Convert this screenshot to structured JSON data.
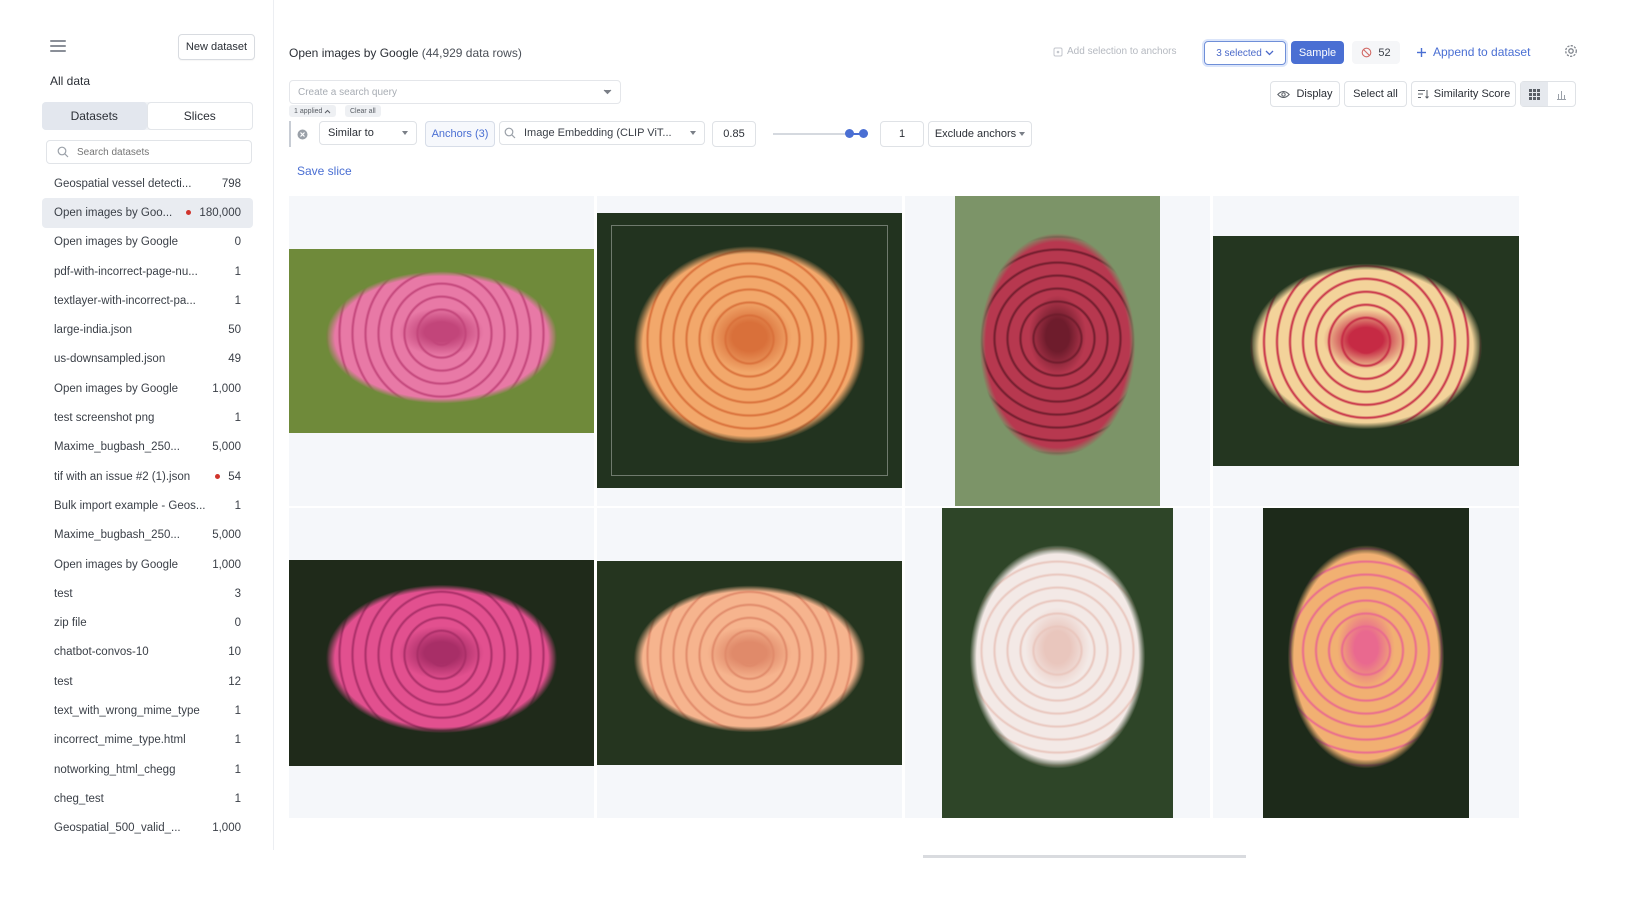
{
  "sidebar": {
    "new_dataset_label": "New dataset",
    "all_data_label": "All data",
    "tabs": [
      {
        "label": "Datasets",
        "active": true
      },
      {
        "label": "Slices",
        "active": false
      }
    ],
    "search_placeholder": "Search datasets",
    "datasets": [
      {
        "name": "Geospatial vessel detecti...",
        "count": "798",
        "alert": false,
        "selected": false
      },
      {
        "name": "Open images by Goo...",
        "count": "180,000",
        "alert": true,
        "selected": true
      },
      {
        "name": "Open images by Google",
        "count": "0",
        "alert": false,
        "selected": false
      },
      {
        "name": "pdf-with-incorrect-page-nu...",
        "count": "1",
        "alert": false,
        "selected": false
      },
      {
        "name": "textlayer-with-incorrect-pa...",
        "count": "1",
        "alert": false,
        "selected": false
      },
      {
        "name": "large-india.json",
        "count": "50",
        "alert": false,
        "selected": false
      },
      {
        "name": "us-downsampled.json",
        "count": "49",
        "alert": false,
        "selected": false
      },
      {
        "name": "Open images by Google",
        "count": "1,000",
        "alert": false,
        "selected": false
      },
      {
        "name": "test screenshot png",
        "count": "1",
        "alert": false,
        "selected": false
      },
      {
        "name": "Maxime_bugbash_250...",
        "count": "5,000",
        "alert": false,
        "selected": false
      },
      {
        "name": "tif with an issue #2 (1).json",
        "count": "54",
        "alert": true,
        "selected": false
      },
      {
        "name": "Bulk import example - Geos...",
        "count": "1",
        "alert": false,
        "selected": false
      },
      {
        "name": "Maxime_bugbash_250...",
        "count": "5,000",
        "alert": false,
        "selected": false
      },
      {
        "name": "Open images by Google",
        "count": "1,000",
        "alert": false,
        "selected": false
      },
      {
        "name": "test",
        "count": "3",
        "alert": false,
        "selected": false
      },
      {
        "name": "zip file",
        "count": "0",
        "alert": false,
        "selected": false
      },
      {
        "name": "chatbot-convos-10",
        "count": "10",
        "alert": false,
        "selected": false
      },
      {
        "name": "test",
        "count": "12",
        "alert": false,
        "selected": false
      },
      {
        "name": "text_with_wrong_mime_type",
        "count": "1",
        "alert": false,
        "selected": false
      },
      {
        "name": "incorrect_mime_type.html",
        "count": "1",
        "alert": false,
        "selected": false
      },
      {
        "name": "notworking_html_chegg",
        "count": "1",
        "alert": false,
        "selected": false
      },
      {
        "name": "cheg_test",
        "count": "1",
        "alert": false,
        "selected": false
      },
      {
        "name": "Geospatial_500_valid_...",
        "count": "1,000",
        "alert": false,
        "selected": false
      }
    ]
  },
  "header": {
    "title": "Open images by Google",
    "row_count": "(44,929 data rows)",
    "add_selection_label": "Add selection to anchors",
    "selected_label": "3 selected",
    "sample_label": "Sample",
    "excluded_count": "52",
    "append_label": "Append to dataset"
  },
  "search": {
    "placeholder": "Create a search query",
    "applied_label": "1 applied",
    "clear_all_label": "Clear all"
  },
  "toolbar": {
    "display_label": "Display",
    "select_all_label": "Select all",
    "similarity_label": "Similarity Score"
  },
  "filter": {
    "operator": "Similar to",
    "anchors_label": "Anchors (3)",
    "embedding": "Image Embedding (CLIP ViT...",
    "threshold": "0.85",
    "k_value": "1",
    "exclude_label": "Exclude anchors"
  },
  "save_slice_label": "Save slice",
  "images": [
    {
      "name": "pink rose",
      "colors": [
        "#6f8a3a",
        "#e879a6",
        "#c2457a"
      ]
    },
    {
      "name": "orange rose",
      "colors": [
        "#22331f",
        "#f2a86b",
        "#d9703a"
      ]
    },
    {
      "name": "dark red rose",
      "colors": [
        "#7c9468",
        "#b7384f",
        "#6e1c2c"
      ]
    },
    {
      "name": "cream red-edged rose",
      "colors": [
        "#243620",
        "#f3d39a",
        "#c62a44"
      ]
    },
    {
      "name": "magenta rose",
      "colors": [
        "#1f2a1a",
        "#e2508f",
        "#a82e67"
      ]
    },
    {
      "name": "peach rose",
      "colors": [
        "#25351f",
        "#f6b48e",
        "#e08a6a"
      ]
    },
    {
      "name": "white rose",
      "colors": [
        "#2e4528",
        "#f3e9e6",
        "#e9c6bd"
      ]
    },
    {
      "name": "pink-yellow rose",
      "colors": [
        "#1d2a1a",
        "#f1b072",
        "#e9698f"
      ]
    }
  ]
}
